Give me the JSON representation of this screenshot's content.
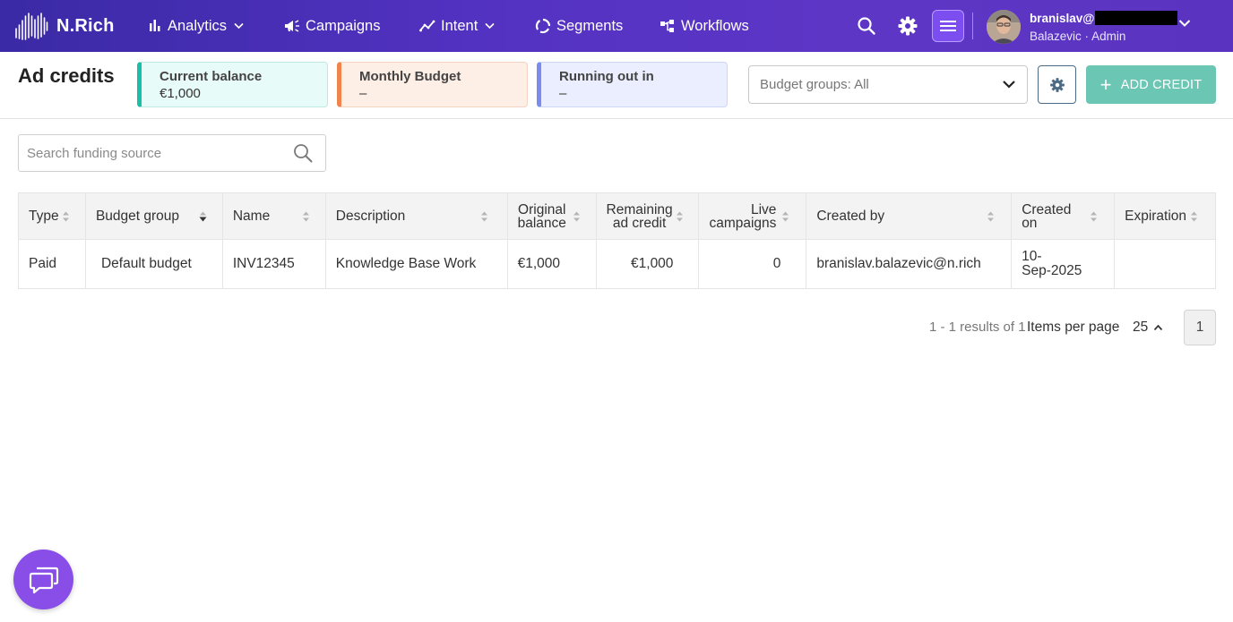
{
  "app": {
    "brand": "N.Rich"
  },
  "nav": {
    "analytics": "Analytics",
    "campaigns": "Campaigns",
    "intent": "Intent",
    "segments": "Segments",
    "workflows": "Workflows"
  },
  "user": {
    "name": "branislav@",
    "surname": "Balazevic",
    "separator": "·",
    "role": "Admin"
  },
  "page": {
    "title": "Ad credits"
  },
  "stats": {
    "current_balance": {
      "label": "Current balance",
      "value": "€1,000",
      "accent": "#19bfa6"
    },
    "monthly_budget": {
      "label": "Monthly Budget",
      "value": "–",
      "accent": "#f0844c"
    },
    "running_out": {
      "label": "Running out in",
      "value": "–",
      "accent": "#7b8cf0"
    }
  },
  "filters": {
    "budget_groups": "Budget groups: All"
  },
  "actions": {
    "add_credit": "ADD CREDIT",
    "accent": "#6cc6b4"
  },
  "search": {
    "placeholder": "Search funding source",
    "value": ""
  },
  "table": {
    "columns": [
      {
        "l1": "Type",
        "l2": ""
      },
      {
        "l1": "Budget group",
        "l2": ""
      },
      {
        "l1": "Name",
        "l2": ""
      },
      {
        "l1": "Description",
        "l2": ""
      },
      {
        "l1": "Original",
        "l2": "balance"
      },
      {
        "l1": "Remaining",
        "l2": "ad credit"
      },
      {
        "l1": "Live",
        "l2": "campaigns"
      },
      {
        "l1": "Created by",
        "l2": ""
      },
      {
        "l1": "Created",
        "l2": "on"
      },
      {
        "l1": "Expiration",
        "l2": ""
      }
    ],
    "rows": [
      {
        "type": "Paid",
        "budget_group": "Default budget",
        "name": "INV12345",
        "description": "Knowledge Base Work",
        "original_balance": "€1,000",
        "remaining_credit": "€1,000",
        "live_campaigns": "0",
        "created_by": "branislav.balazevic@n.rich",
        "created_on_l1": "10-",
        "created_on_l2": "Sep-2025",
        "expiration": ""
      }
    ]
  },
  "pagination": {
    "range": "1 - 1 results of 1",
    "items_per_page_label": "Items per page",
    "items_per_page": "25",
    "current_page": "1"
  },
  "icons": {
    "brand": "nrich-logo-icon",
    "analytics": "bar-chart-icon",
    "campaigns": "megaphone-icon",
    "intent": "trend-icon",
    "segments": "segments-icon",
    "workflows": "workflow-icon",
    "search": "search-icon",
    "settings": "gear-icon",
    "menu": "menu-icon",
    "chat": "chat-icon"
  }
}
